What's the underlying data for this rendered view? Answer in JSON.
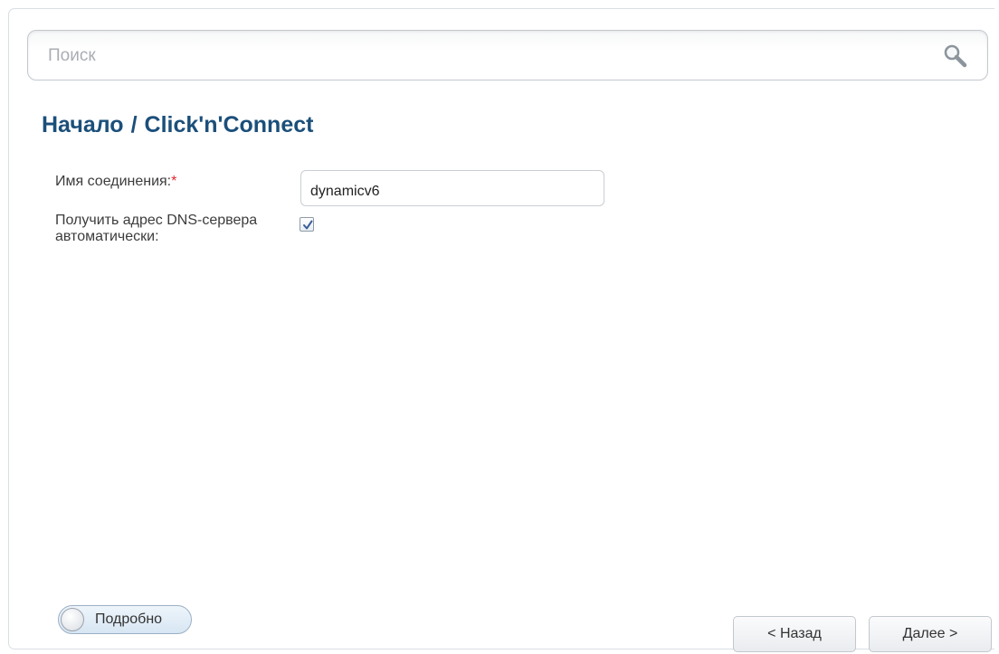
{
  "search": {
    "placeholder": "Поиск",
    "value": "",
    "icon": "search-icon"
  },
  "breadcrumb": {
    "root": "Начало",
    "separator": "/",
    "current": "Click'n'Connect"
  },
  "form": {
    "connection_name": {
      "label": "Имя соединения:",
      "required_mark": "*",
      "value": "dynamicv6"
    },
    "dns_auto": {
      "label_line1": "Получить адрес DNS-сервера",
      "label_line2": "автоматически:",
      "checked": true
    }
  },
  "advanced_toggle": {
    "label": "Подробно",
    "on": false
  },
  "buttons": {
    "back": "< Назад",
    "next": "Далее >"
  },
  "colors": {
    "title": "#1b4f7a",
    "required": "#e0282d",
    "checkmark": "#3a5f9a"
  }
}
